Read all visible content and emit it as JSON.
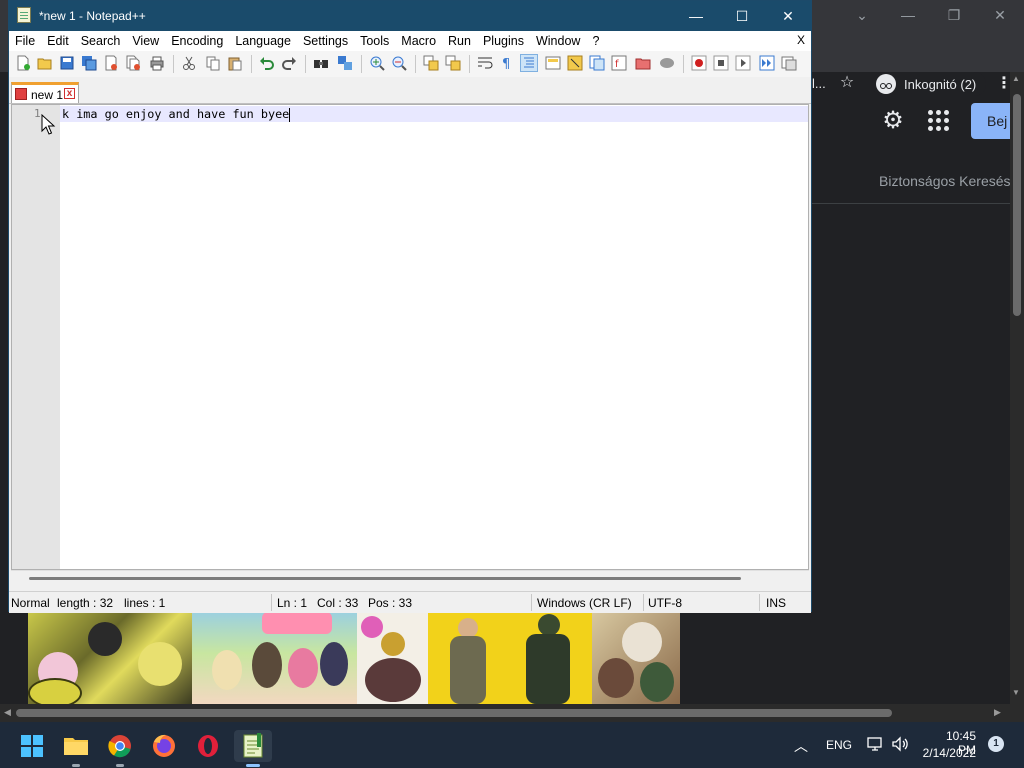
{
  "chrome": {
    "tab_fragment": "l...",
    "incognito_label": "Inkognitó (2)",
    "signin_label": "Bej",
    "safe_search": "Biztonságos Keresés",
    "window_controls": {
      "minimize": "—",
      "restore": "❐",
      "close": "✕",
      "tab_search": "⌄"
    }
  },
  "notepad": {
    "title": "*new 1 - Notepad++",
    "window_controls": {
      "minimize": "—",
      "maximize": "☐",
      "close": "✕"
    },
    "menu": [
      "File",
      "Edit",
      "Search",
      "View",
      "Encoding",
      "Language",
      "Settings",
      "Tools",
      "Macro",
      "Run",
      "Plugins",
      "Window",
      "?"
    ],
    "close_doc": "X",
    "tab": {
      "label": "new 1",
      "close": "x"
    },
    "editor": {
      "line_number": "1",
      "text": "k ima go enjoy and have fun byee"
    },
    "status": {
      "mode": "Normal",
      "length": "length : 32",
      "lines": "lines : 1",
      "ln": "Ln : 1",
      "col": "Col : 33",
      "pos": "Pos : 33",
      "eol": "Windows (CR LF)",
      "encoding": "UTF-8",
      "ins": "INS"
    }
  },
  "taskbar": {
    "apps": [
      "start",
      "file-explorer",
      "chrome",
      "firefox",
      "opera",
      "notepad-plus-plus"
    ],
    "tray": {
      "language": "ENG",
      "time": "10:45 PM",
      "date": "2/14/2022",
      "notifications": "1"
    }
  }
}
